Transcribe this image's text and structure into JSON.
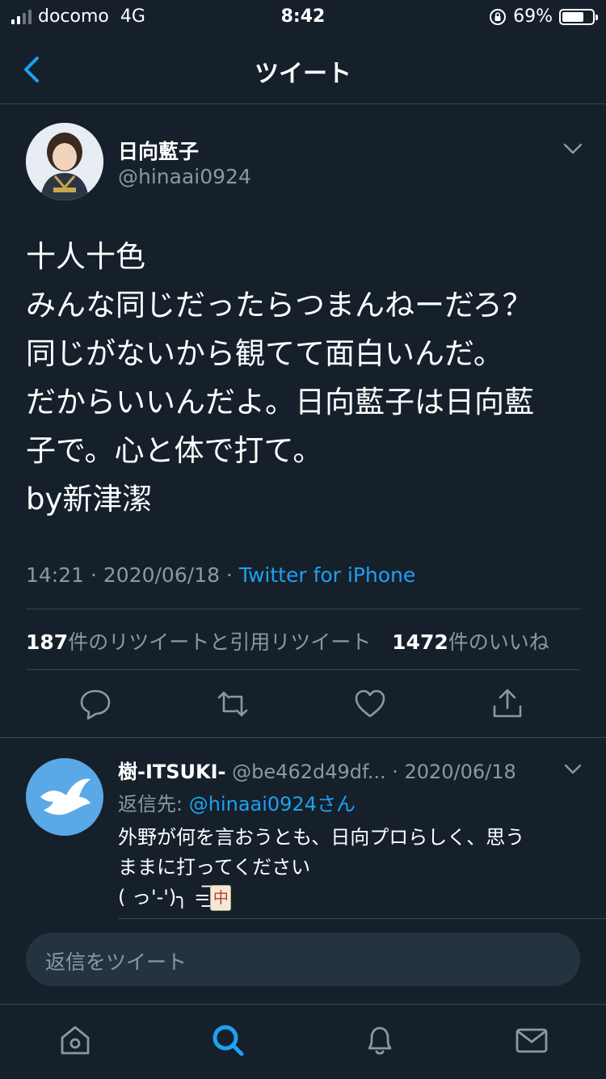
{
  "status_bar": {
    "carrier": "docomo",
    "network": "4G",
    "time": "8:42",
    "battery": "69%",
    "icons": [
      "signal-icon",
      "orientation-lock-icon",
      "battery-icon"
    ]
  },
  "header": {
    "title": "ツイート",
    "back_icon": "chevron-left-icon"
  },
  "tweet": {
    "display_name": "日向藍子",
    "handle": "@hinaai0924",
    "text": "十人十色\nみんな同じだったらつまんねーだろ？\n同じがないから観てて面白いんだ。\nだからいいんだよ。日向藍子は日向藍\n子で。心と体で打て。\nby新津潔",
    "time": "14:21",
    "date": "2020/06/18",
    "separator": " · ",
    "source": "Twitter for iPhone",
    "retweets_count": "187",
    "retweets_label": "件のリツイートと引用リツイート",
    "likes_count": "1472",
    "likes_label": "件のいいね",
    "action_icons": [
      "reply-icon",
      "retweet-icon",
      "like-icon",
      "share-icon"
    ]
  },
  "reply": {
    "display_name": "樹-ITSUKI-",
    "handle": "@be462d49df...",
    "date": "· 2020/06/18",
    "replying_label": "返信先:",
    "replying_to": "@hinaai0924さん",
    "text": "外野が何を言おうとも、日向プロらしく、思う\nままに打ってください\n( っ'-')╮ =͟͟͞͞",
    "tile_char": "中"
  },
  "compose": {
    "placeholder": "返信をツイート"
  },
  "tabbar": {
    "items": [
      "home-icon",
      "search-icon",
      "notifications-icon",
      "messages-icon"
    ],
    "active": "search-icon"
  },
  "colors": {
    "background": "#15202b",
    "accent": "#1da1f2",
    "secondary_text": "#8899a6",
    "divider": "#38444d"
  }
}
